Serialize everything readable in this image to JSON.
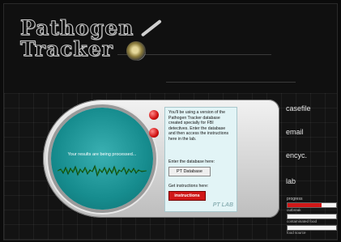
{
  "logo": {
    "line1": "Pathogen",
    "line2": "Tracker"
  },
  "screen": {
    "status_text": "Your results are being processed..."
  },
  "panel": {
    "intro": "You'll be using a version of the Pathogen Tracker database created specially for FBI detectives. Enter the database and then access the instructions here in the lab.",
    "enter_label": "Enter the database here:",
    "database_button": "PT Database",
    "instructions_label": "Get instructions here:",
    "instructions_button": "instructions",
    "brand": "PT LAB"
  },
  "nav": {
    "items": [
      "casefile",
      "email",
      "encyc.",
      "lab"
    ]
  },
  "progress": {
    "label": "progress",
    "bars": [
      {
        "label": "outbreak",
        "value": 0.7
      },
      {
        "label": "contaminated food",
        "value": 0
      },
      {
        "label": "food source",
        "value": 0
      }
    ]
  },
  "colors": {
    "accent": "#d01818",
    "screen": "#168c8e",
    "panel": "#e2f4f6"
  }
}
